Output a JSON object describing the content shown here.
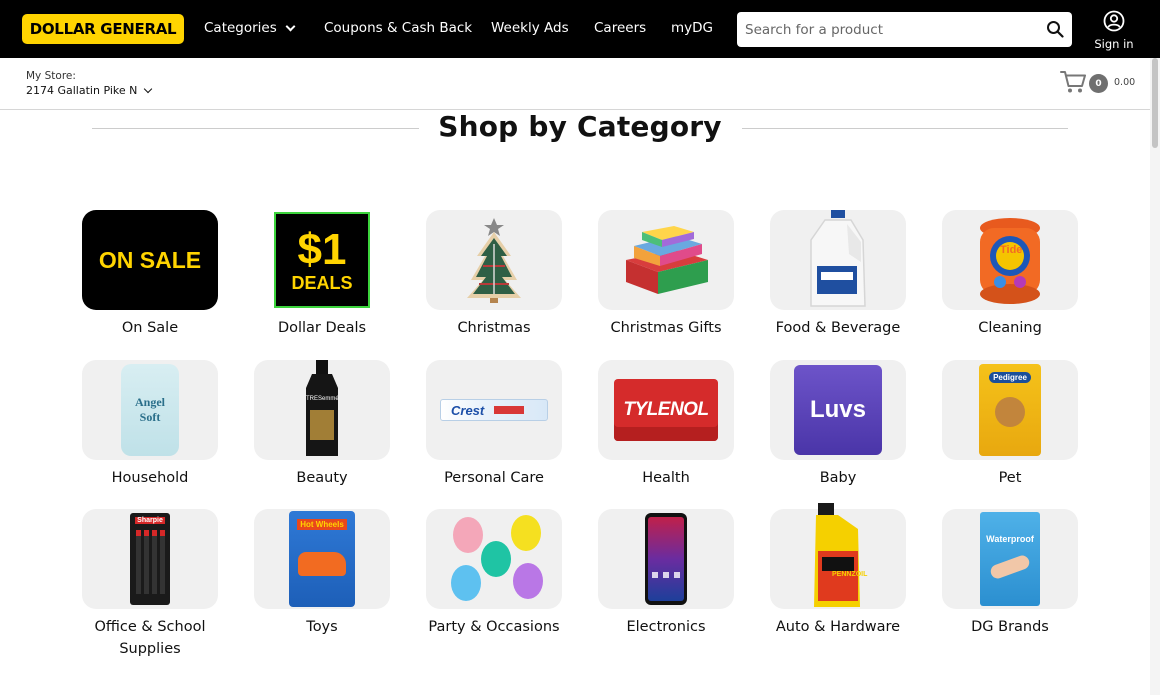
{
  "brand": {
    "logo_text": "DOLLAR GENERAL",
    "accent": "#ffd400",
    "nav_bg": "#000000"
  },
  "nav": {
    "categories": "Categories",
    "coupons": "Coupons & Cash Back",
    "weekly_ads": "Weekly Ads",
    "careers": "Careers",
    "mydg": "myDG"
  },
  "search": {
    "placeholder": "Search for a product",
    "value": ""
  },
  "account": {
    "signin": "Sign in"
  },
  "store": {
    "label": "My Store:",
    "name": "2174 Gallatin Pike N"
  },
  "cart": {
    "count": "0",
    "total": "0.00"
  },
  "page": {
    "heading": "Shop by Category"
  },
  "categories": [
    {
      "label": "On Sale",
      "image_text": "ON SALE"
    },
    {
      "label": "Dollar Deals",
      "image_text": "$1",
      "image_subtext": "DEALS"
    },
    {
      "label": "Christmas"
    },
    {
      "label": "Christmas Gifts"
    },
    {
      "label": "Food & Beverage"
    },
    {
      "label": "Cleaning",
      "image_text": "Tide"
    },
    {
      "label": "Household",
      "image_text": "Angel Soft"
    },
    {
      "label": "Beauty",
      "image_text": "TRESemmé"
    },
    {
      "label": "Personal Care",
      "image_text": "Crest"
    },
    {
      "label": "Health",
      "image_text": "TYLENOL"
    },
    {
      "label": "Baby",
      "image_text": "Luvs"
    },
    {
      "label": "Pet",
      "image_text": "Pedigree"
    },
    {
      "label": "Office & School Supplies",
      "image_text": "Sharpie"
    },
    {
      "label": "Toys",
      "image_text": "Hot Wheels"
    },
    {
      "label": "Party & Occasions"
    },
    {
      "label": "Electronics"
    },
    {
      "label": "Auto & Hardware",
      "image_text": "PENNZOIL"
    },
    {
      "label": "DG Brands",
      "image_text": "Waterproof"
    }
  ]
}
